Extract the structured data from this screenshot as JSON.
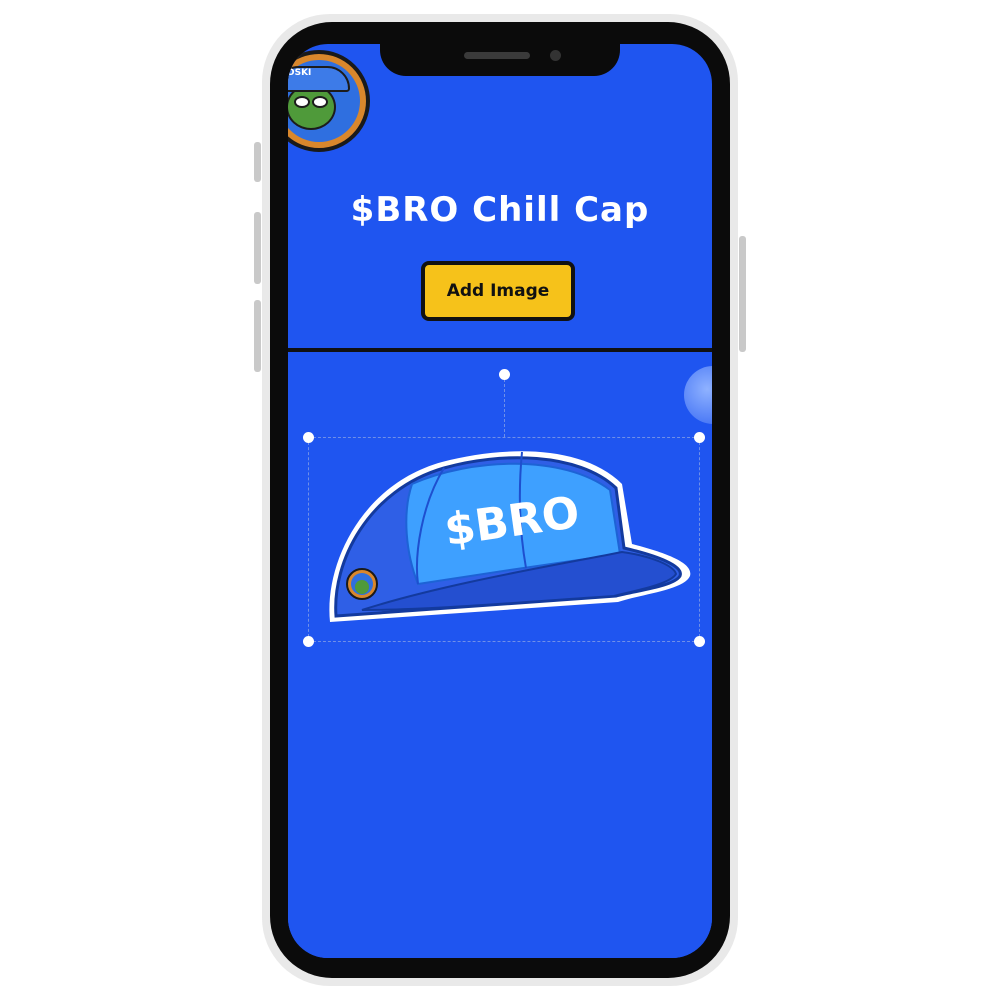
{
  "header": {
    "title": "$BRO Chill Cap",
    "add_image_label": "Add Image",
    "avatar_text": "ROSKI"
  },
  "canvas": {
    "cap_text": "$BRO"
  },
  "colors": {
    "screen_bg": "#1f55f0",
    "button_bg": "#f6c21a",
    "cap_blue": "#2f5fe6",
    "cap_light": "#3ea0ff"
  },
  "icons": [
    "avatar-icon",
    "cap-image",
    "selection-handle"
  ]
}
